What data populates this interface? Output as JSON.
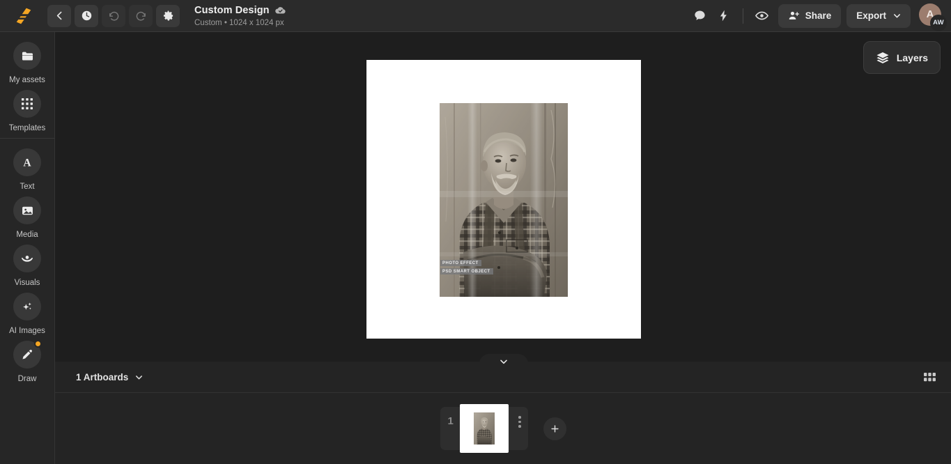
{
  "app": {
    "logo_icon": "pixelied-logo-icon",
    "accent": "#f5a623",
    "bg": "#1e1e1e",
    "panel_bg": "#242424",
    "topbar_bg": "#2b2b2b"
  },
  "topbar": {
    "back_icon": "chevron-left-icon",
    "history_icon": "clock-icon",
    "undo_icon": "undo-icon",
    "redo_icon": "redo-icon",
    "settings_icon": "gear-icon",
    "title": "Custom Design",
    "cloud_icon": "cloud-check-icon",
    "subtitle": "Custom • 1024 x 1024 px",
    "comment_icon": "comment-icon",
    "bolt_icon": "lightning-bolt-icon",
    "preview_icon": "eye-icon",
    "share_icon": "user-plus-icon",
    "share_label": "Share",
    "export_label": "Export",
    "export_caret_icon": "chevron-down-icon",
    "avatar_initial": "A",
    "avatar_badge": "AW"
  },
  "sidebar": {
    "items": [
      {
        "label": "My assets",
        "icon": "folder-icon",
        "badge": false
      },
      {
        "label": "Templates",
        "icon": "grid-dots-icon",
        "badge": false
      },
      {
        "label": "Text",
        "icon": "text-a-icon",
        "badge": false
      },
      {
        "label": "Media",
        "icon": "image-icon",
        "badge": false
      },
      {
        "label": "Visuals",
        "icon": "lotus-shape-icon",
        "badge": false
      },
      {
        "label": "AI Images",
        "icon": "sparkles-icon",
        "badge": false
      },
      {
        "label": "Draw",
        "icon": "pen-icon",
        "badge": true
      }
    ],
    "separator_after_index": 1
  },
  "canvas": {
    "layers_label": "Layers",
    "layers_icon": "layers-stack-icon",
    "collapse_icon": "chevron-down-icon",
    "artboard": {
      "overlay_line_1": "PHOTO EFFECT",
      "overlay_line_2": "PSD SMART OBJECT",
      "description": "Vintage sepia portrait of a bearded older man with arms crossed wearing a plaid flannel shirt"
    }
  },
  "bottom_panel": {
    "artboard_count_label": "1 Artboards",
    "caret_icon": "chevron-down-icon",
    "grid_view_icon": "grid-view-icon",
    "artboards": [
      {
        "number": "1",
        "menu_icon": "kebab-menu-icon"
      }
    ],
    "add_label": "+",
    "add_icon": "plus-icon"
  }
}
